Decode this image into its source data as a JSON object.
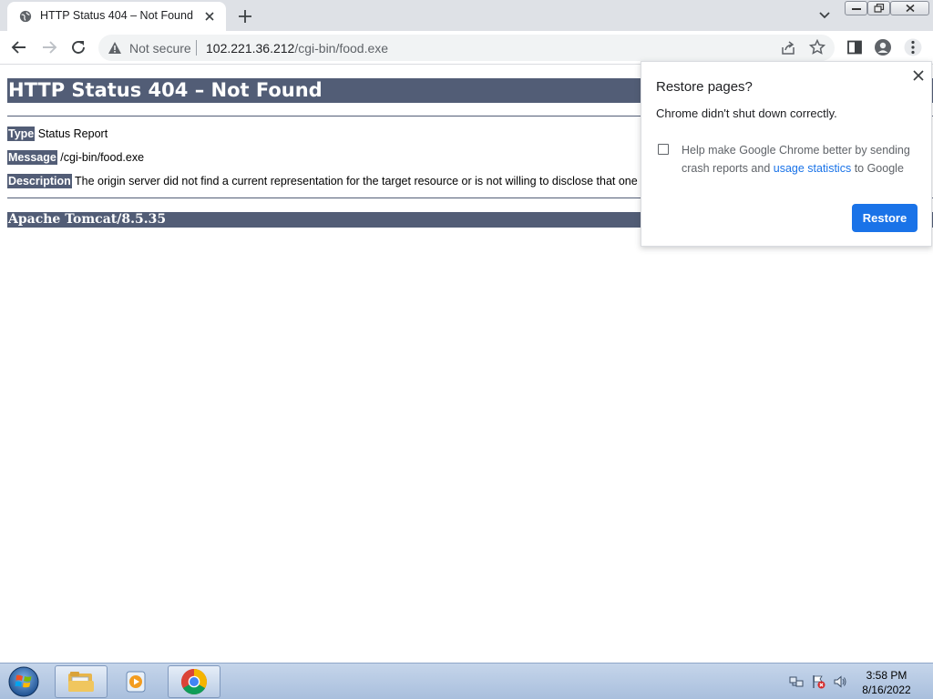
{
  "browser": {
    "tab": {
      "title": "HTTP Status 404 – Not Found"
    },
    "omnibox": {
      "security_label": "Not secure",
      "url_host": "102.221.36.212",
      "url_path": "/cgi-bin/food.exe"
    }
  },
  "page": {
    "heading": "HTTP Status 404 – Not Found",
    "rows": [
      {
        "label": "Type",
        "value": "Status Report"
      },
      {
        "label": "Message",
        "value": "/cgi-bin/food.exe"
      },
      {
        "label": "Description",
        "value": "The origin server did not find a current representation for the target resource or is not willing to disclose that one exists."
      }
    ],
    "server": "Apache Tomcat/8.5.35"
  },
  "restore_dialog": {
    "title": "Restore pages?",
    "message": "Chrome didn't shut down correctly.",
    "checkbox_text_before": "Help make Google Chrome better by sending crash reports and ",
    "checkbox_link": "usage statistics",
    "checkbox_text_after": " to Google",
    "checked": false,
    "restore_button": "Restore"
  },
  "taskbar": {
    "time": "3:58 PM",
    "date": "8/16/2022"
  }
}
